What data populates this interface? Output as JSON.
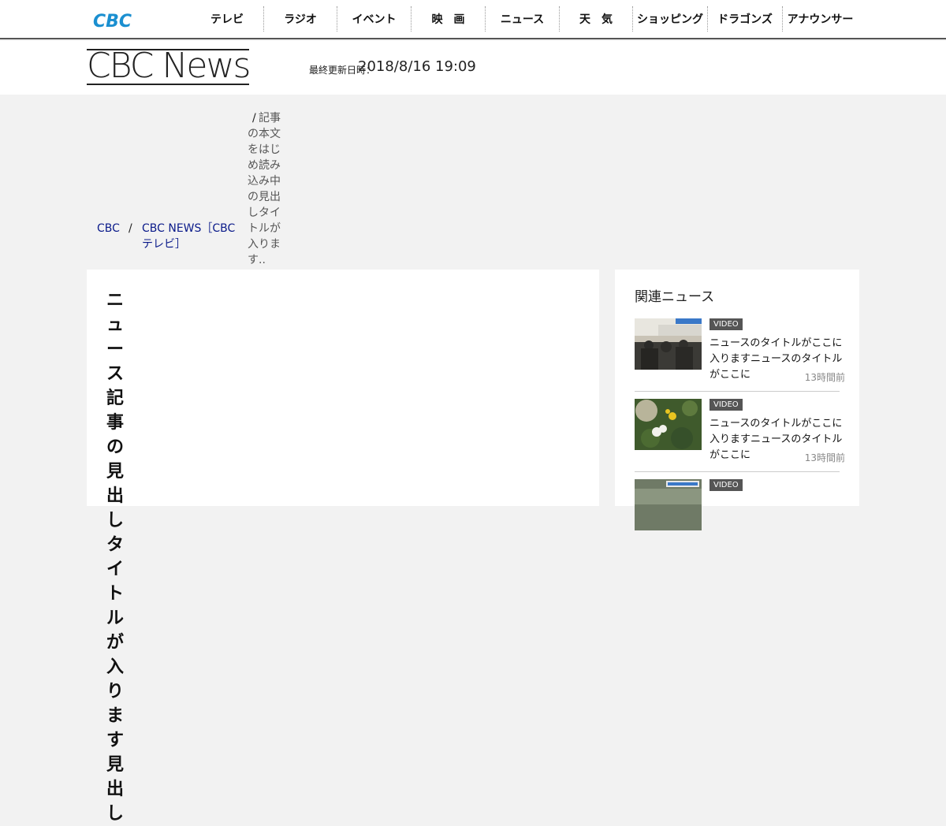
{
  "nav": {
    "items": [
      "テレビ",
      "ラジオ",
      "イベント",
      "映　画",
      "ニュース",
      "天　気",
      "ショッピング",
      "ドラゴンズ",
      "アナウンサー"
    ],
    "logo_text": "CBC"
  },
  "header": {
    "brand": "CBC News",
    "updated_label": "最終更新日時：",
    "updated_time": "2018/8/16 19:09"
  },
  "breadcrumb": {
    "home": "CBC",
    "sep": "/",
    "section": "CBC NEWS［CBCテレビ］",
    "article": "　記事の本文をはじめ読み込み中の見出しタイトルが入ります.."
  },
  "article": {
    "headline": "ニュース記事の見出しタイトルが入ります見出し"
  },
  "sidebar": {
    "title": "関連ニュース",
    "items": [
      {
        "badge": "VIDEO",
        "title": "ニュースのタイトルがここに入りますニュースのタイトルがここに",
        "ago": "13時間前"
      },
      {
        "badge": "VIDEO",
        "title": "ニュースのタイトルがここに入りますニュースのタイトルがここに",
        "ago": "13時間前"
      },
      {
        "badge": "VIDEO",
        "title": "",
        "ago": ""
      }
    ]
  },
  "colors": {
    "logo": "#1a8fd0",
    "link": "#0a1a8a",
    "badge": "#555555"
  }
}
